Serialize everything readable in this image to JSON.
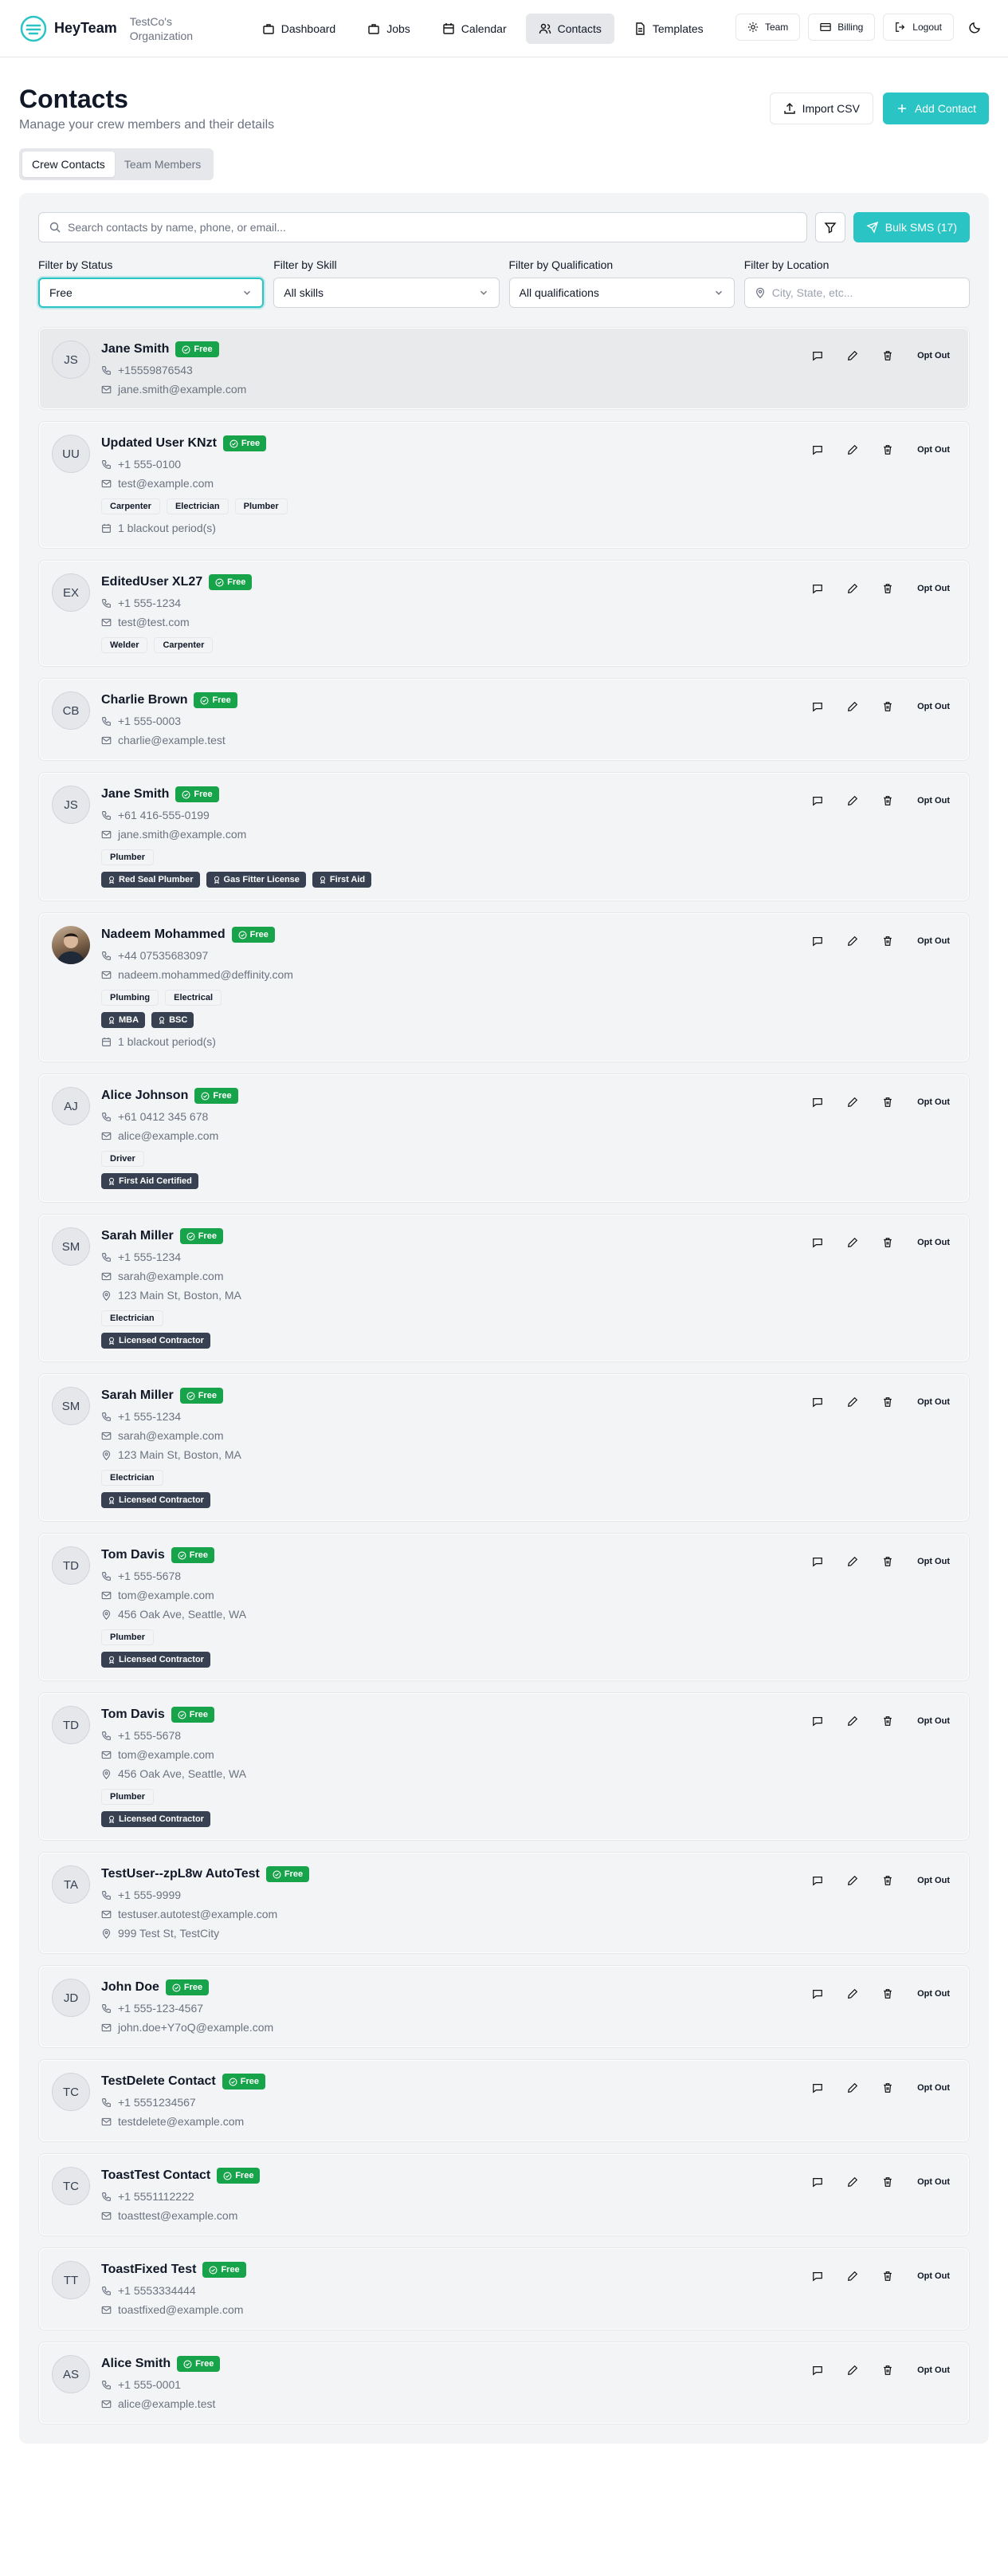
{
  "nav": {
    "brand": "HeyTeam",
    "org": "TestCo's Organization",
    "links": [
      {
        "label": "Dashboard",
        "icon": "briefcase-icon"
      },
      {
        "label": "Jobs",
        "icon": "briefcase-icon"
      },
      {
        "label": "Calendar",
        "icon": "calendar-icon"
      },
      {
        "label": "Contacts",
        "icon": "users-icon",
        "active": true
      },
      {
        "label": "Templates",
        "icon": "file-icon"
      }
    ],
    "right": [
      {
        "label": "Team",
        "icon": "gear-icon"
      },
      {
        "label": "Billing",
        "icon": "card-icon"
      },
      {
        "label": "Logout",
        "icon": "logout-icon"
      }
    ]
  },
  "header": {
    "title": "Contacts",
    "subtitle": "Manage your crew members and their details",
    "import_label": "Import CSV",
    "add_label": "Add Contact"
  },
  "tabs": [
    {
      "label": "Crew Contacts",
      "active": true
    },
    {
      "label": "Team Members",
      "active": false
    }
  ],
  "search": {
    "placeholder": "Search contacts by name, phone, or email...",
    "bulk_label": "Bulk SMS (17)"
  },
  "filters": {
    "status": {
      "label": "Filter by Status",
      "value": "Free"
    },
    "skill": {
      "label": "Filter by Skill",
      "value": "All skills"
    },
    "qualification": {
      "label": "Filter by Qualification",
      "value": "All qualifications"
    },
    "location": {
      "label": "Filter by Location",
      "placeholder": "City, State, etc..."
    }
  },
  "card_labels": {
    "opt_out": "Opt Out"
  },
  "colors": {
    "accent": "#2bc4c4",
    "status_free": "#16a34a",
    "qual_bg": "#374151"
  },
  "contacts": [
    {
      "initials": "JS",
      "name": "Jane Smith",
      "status": "Free",
      "phone": "+15559876543",
      "email": "jane.smith@example.com",
      "address": "",
      "skills": [],
      "quals": [],
      "blackout": "",
      "hover": true
    },
    {
      "initials": "UU",
      "name": "Updated User KNzt",
      "status": "Free",
      "phone": "+1 555-0100",
      "email": "test@example.com",
      "address": "",
      "skills": [
        "Carpenter",
        "Electrician",
        "Plumber"
      ],
      "quals": [],
      "blackout": "1 blackout period(s)"
    },
    {
      "initials": "EX",
      "name": "EditedUser XL27",
      "status": "Free",
      "phone": "+1 555-1234",
      "email": "test@test.com",
      "address": "",
      "skills": [
        "Welder",
        "Carpenter"
      ],
      "quals": [],
      "blackout": ""
    },
    {
      "initials": "CB",
      "name": "Charlie Brown",
      "status": "Free",
      "phone": "+1 555-0003",
      "email": "charlie@example.test",
      "address": "",
      "skills": [],
      "quals": [],
      "blackout": ""
    },
    {
      "initials": "JS",
      "name": "Jane Smith",
      "status": "Free",
      "phone": "+61 416-555-0199",
      "email": "jane.smith@example.com",
      "address": "",
      "skills": [
        "Plumber"
      ],
      "quals": [
        "Red Seal Plumber",
        "Gas Fitter License",
        "First Aid"
      ],
      "blackout": ""
    },
    {
      "initials": "",
      "photo": true,
      "name": "Nadeem Mohammed",
      "status": "Free",
      "phone": "+44 07535683097",
      "email": "nadeem.mohammed@deffinity.com",
      "address": "",
      "skills": [
        "Plumbing",
        "Electrical"
      ],
      "quals": [
        "MBA",
        "BSC"
      ],
      "blackout": "1 blackout period(s)"
    },
    {
      "initials": "AJ",
      "name": "Alice Johnson",
      "status": "Free",
      "phone": "+61 0412 345 678",
      "email": "alice@example.com",
      "address": "",
      "skills": [
        "Driver"
      ],
      "quals": [
        "First Aid Certified"
      ],
      "blackout": ""
    },
    {
      "initials": "SM",
      "name": "Sarah Miller",
      "status": "Free",
      "phone": "+1 555-1234",
      "email": "sarah@example.com",
      "address": "123 Main St, Boston, MA",
      "skills": [
        "Electrician"
      ],
      "quals": [
        "Licensed Contractor"
      ],
      "blackout": ""
    },
    {
      "initials": "SM",
      "name": "Sarah Miller",
      "status": "Free",
      "phone": "+1 555-1234",
      "email": "sarah@example.com",
      "address": "123 Main St, Boston, MA",
      "skills": [
        "Electrician"
      ],
      "quals": [
        "Licensed Contractor"
      ],
      "blackout": ""
    },
    {
      "initials": "TD",
      "name": "Tom Davis",
      "status": "Free",
      "phone": "+1 555-5678",
      "email": "tom@example.com",
      "address": "456 Oak Ave, Seattle, WA",
      "skills": [
        "Plumber"
      ],
      "quals": [
        "Licensed Contractor"
      ],
      "blackout": ""
    },
    {
      "initials": "TD",
      "name": "Tom Davis",
      "status": "Free",
      "phone": "+1 555-5678",
      "email": "tom@example.com",
      "address": "456 Oak Ave, Seattle, WA",
      "skills": [
        "Plumber"
      ],
      "quals": [
        "Licensed Contractor"
      ],
      "blackout": ""
    },
    {
      "initials": "TA",
      "name": "TestUser--zpL8w AutoTest",
      "status": "Free",
      "phone": "+1 555-9999",
      "email": "testuser.autotest@example.com",
      "address": "999 Test St, TestCity",
      "skills": [],
      "quals": [],
      "blackout": ""
    },
    {
      "initials": "JD",
      "name": "John Doe",
      "status": "Free",
      "phone": "+1 555-123-4567",
      "email": "john.doe+Y7oQ@example.com",
      "address": "",
      "skills": [],
      "quals": [],
      "blackout": ""
    },
    {
      "initials": "TC",
      "name": "TestDelete Contact",
      "status": "Free",
      "phone": "+1 5551234567",
      "email": "testdelete@example.com",
      "address": "",
      "skills": [],
      "quals": [],
      "blackout": ""
    },
    {
      "initials": "TC",
      "name": "ToastTest Contact",
      "status": "Free",
      "phone": "+1 5551112222",
      "email": "toasttest@example.com",
      "address": "",
      "skills": [],
      "quals": [],
      "blackout": ""
    },
    {
      "initials": "TT",
      "name": "ToastFixed Test",
      "status": "Free",
      "phone": "+1 5553334444",
      "email": "toastfixed@example.com",
      "address": "",
      "skills": [],
      "quals": [],
      "blackout": ""
    },
    {
      "initials": "AS",
      "name": "Alice Smith",
      "status": "Free",
      "phone": "+1 555-0001",
      "email": "alice@example.test",
      "address": "",
      "skills": [],
      "quals": [],
      "blackout": ""
    }
  ]
}
